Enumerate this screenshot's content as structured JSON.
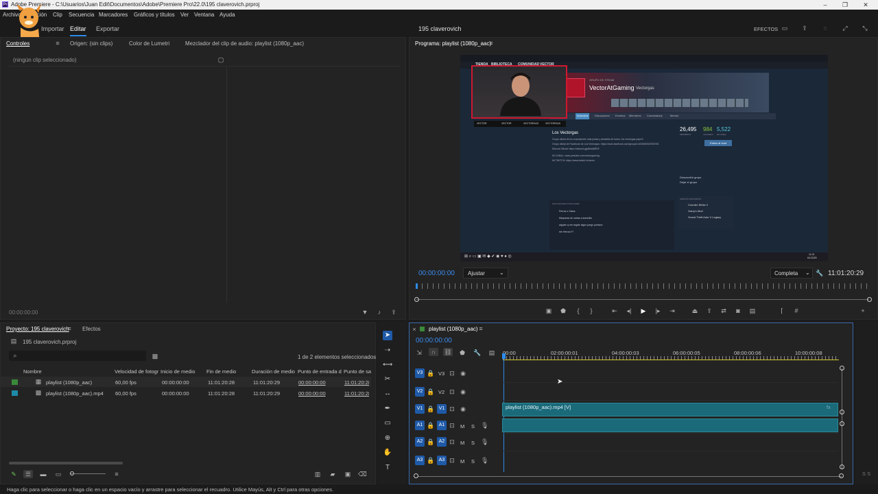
{
  "window": {
    "title": "Adobe Premiere - C:\\Usuarios\\Juan Edit\\Documentos\\Adobe\\Premiere Pro\\22.0\\195 claverovich.prproj",
    "app_icon": "Pr",
    "minimize": "–",
    "restore": "❐",
    "close": "✕"
  },
  "menu": [
    "Archivo",
    "Edición",
    "Clip",
    "Secuencia",
    "Marcadores",
    "Gráficos y títulos",
    "Ver",
    "Ventana",
    "Ayuda"
  ],
  "workspace": {
    "tabs": [
      "Importar",
      "Editar",
      "Exportar"
    ],
    "active_tab": "Editar",
    "project_name": "195 claverovich",
    "right_label": "EFECTOS"
  },
  "source_panel": {
    "tabs": [
      "Controles",
      "Origen: (sin clips)",
      "Color de Lumetri",
      "Mezclador del clip de audio: playlist (1080p_aac)"
    ],
    "no_clip_text": "(ningún clip seleccionado)",
    "timecode": "00:00:00:00"
  },
  "program_monitor": {
    "title": "Programa: playlist (1080p_aac)",
    "timecode": "00:00:00:00",
    "zoom": "Ajustar",
    "quality": "Completa",
    "duration": "11:01:20:29",
    "frame": {
      "nav": [
        "TIENDA",
        "BIBLIOTECA",
        "COMUNIDAD",
        "VECTOR"
      ],
      "group_tag": "GRUPO DE STEAM",
      "group_name": "VectorAtGaming",
      "group_subtitle": "Vectorgas",
      "subtabs": [
        "Página inicial",
        "Anuncios",
        "Discusiones",
        "Eventos",
        "Miembros",
        "Comentarios",
        "Mentor"
      ],
      "heading": "Los Vectorgas",
      "desc_lines": [
        "Grupo oficial de los suscriptores más piolas y amables de todos, los vectorgas papu!!!",
        "Grupo oficial de Facebook de Los Vectorgas: https://www.facebook.com/groups/1403606949783755",
        "Discord Oficial: https://discord.gg/8bdd8RDF",
        "MI CANAL: www.youtube.com/vectorgaming",
        "MI TWITCH: https://www.twitch.tv/vector"
      ],
      "stats": [
        {
          "value": "26,495",
          "label": "MIEMBROS"
        },
        {
          "value": "984",
          "label": "JUGANDO"
        },
        {
          "value": "5,522",
          "label": "EN LÍNEA"
        }
      ],
      "chat_button": "Entrar al chat",
      "leave": [
        "Desuscribir grupo",
        "Dejar el grupo"
      ],
      "games_title": "JUEGOS ASOCIADOS",
      "games": [
        "Counter-Strike 2",
        "Garry's Mod",
        "Grand Theft Auto V Legacy"
      ],
      "discussions_title": "DISCUSIONES POPULARES",
      "discussions": [
        "Perros o Gatos",
        "Máquinas de cartas a domicilio",
        "alguien q me regale algun juego porfavor",
        "me Herooo??"
      ],
      "socials": [
        "VECTOR",
        "VECTOR",
        "VECTORGAS",
        "VECTORGAS"
      ],
      "taskbar_time": "11:01",
      "taskbar_date": "6/1/2025"
    }
  },
  "project_panel": {
    "tabs": [
      "Proyecto: 195 claverovich",
      "Efectos"
    ],
    "file": "195 claverovich.prproj",
    "selection": "1 de 2 elementos seleccionados",
    "columns": [
      "Nombre",
      "Velocidad de fotogramas",
      "Inicio de medio",
      "Fin de medio",
      "Duración de medio",
      "Punto de entrada de vídeo",
      "Punto de salida de vídeo"
    ],
    "rows": [
      {
        "name": "playlist (1080p_aac)",
        "fps": "60,00 fps",
        "start": "00:00:00:00",
        "end": "11:01:20:28",
        "duration": "11:01:20:29",
        "in": "00:00:00:00",
        "out": "11:01:20:28",
        "color": "#3a8a3a"
      },
      {
        "name": "playlist (1080p_aac).mp4",
        "fps": "60,00 fps",
        "start": "00:00:00:00",
        "end": "11:01:20:28",
        "duration": "11:01:20:29",
        "in": "00:00:00:00",
        "out": "11:01:20:28",
        "color": "#1e8aa8"
      }
    ]
  },
  "timeline": {
    "sequence": "playlist (1080p_aac)",
    "timecode": "00:00:00:00",
    "ruler": [
      "00:00",
      "02:00:00:01",
      "04:00:00:03",
      "06:00:00:05",
      "08:00:00:06",
      "10:00:00:08"
    ],
    "video_tracks": [
      "V3",
      "V2",
      "V1"
    ],
    "audio_tracks": [
      "A1",
      "A2",
      "A3"
    ],
    "clip_label": "playlist (1080p_aac).mp4 [V]",
    "fx": "fx"
  },
  "status_bar": "Haga clic para seleccionar o haga clic en un espacio vacío y arrastre para seleccionar el recuadro. Utilice Mayús, Alt y Ctrl para otras opciones.",
  "colors": {
    "accent": "#2d8ceb",
    "clip": "#1a6a7a",
    "track_button": "#1f5aa8"
  }
}
